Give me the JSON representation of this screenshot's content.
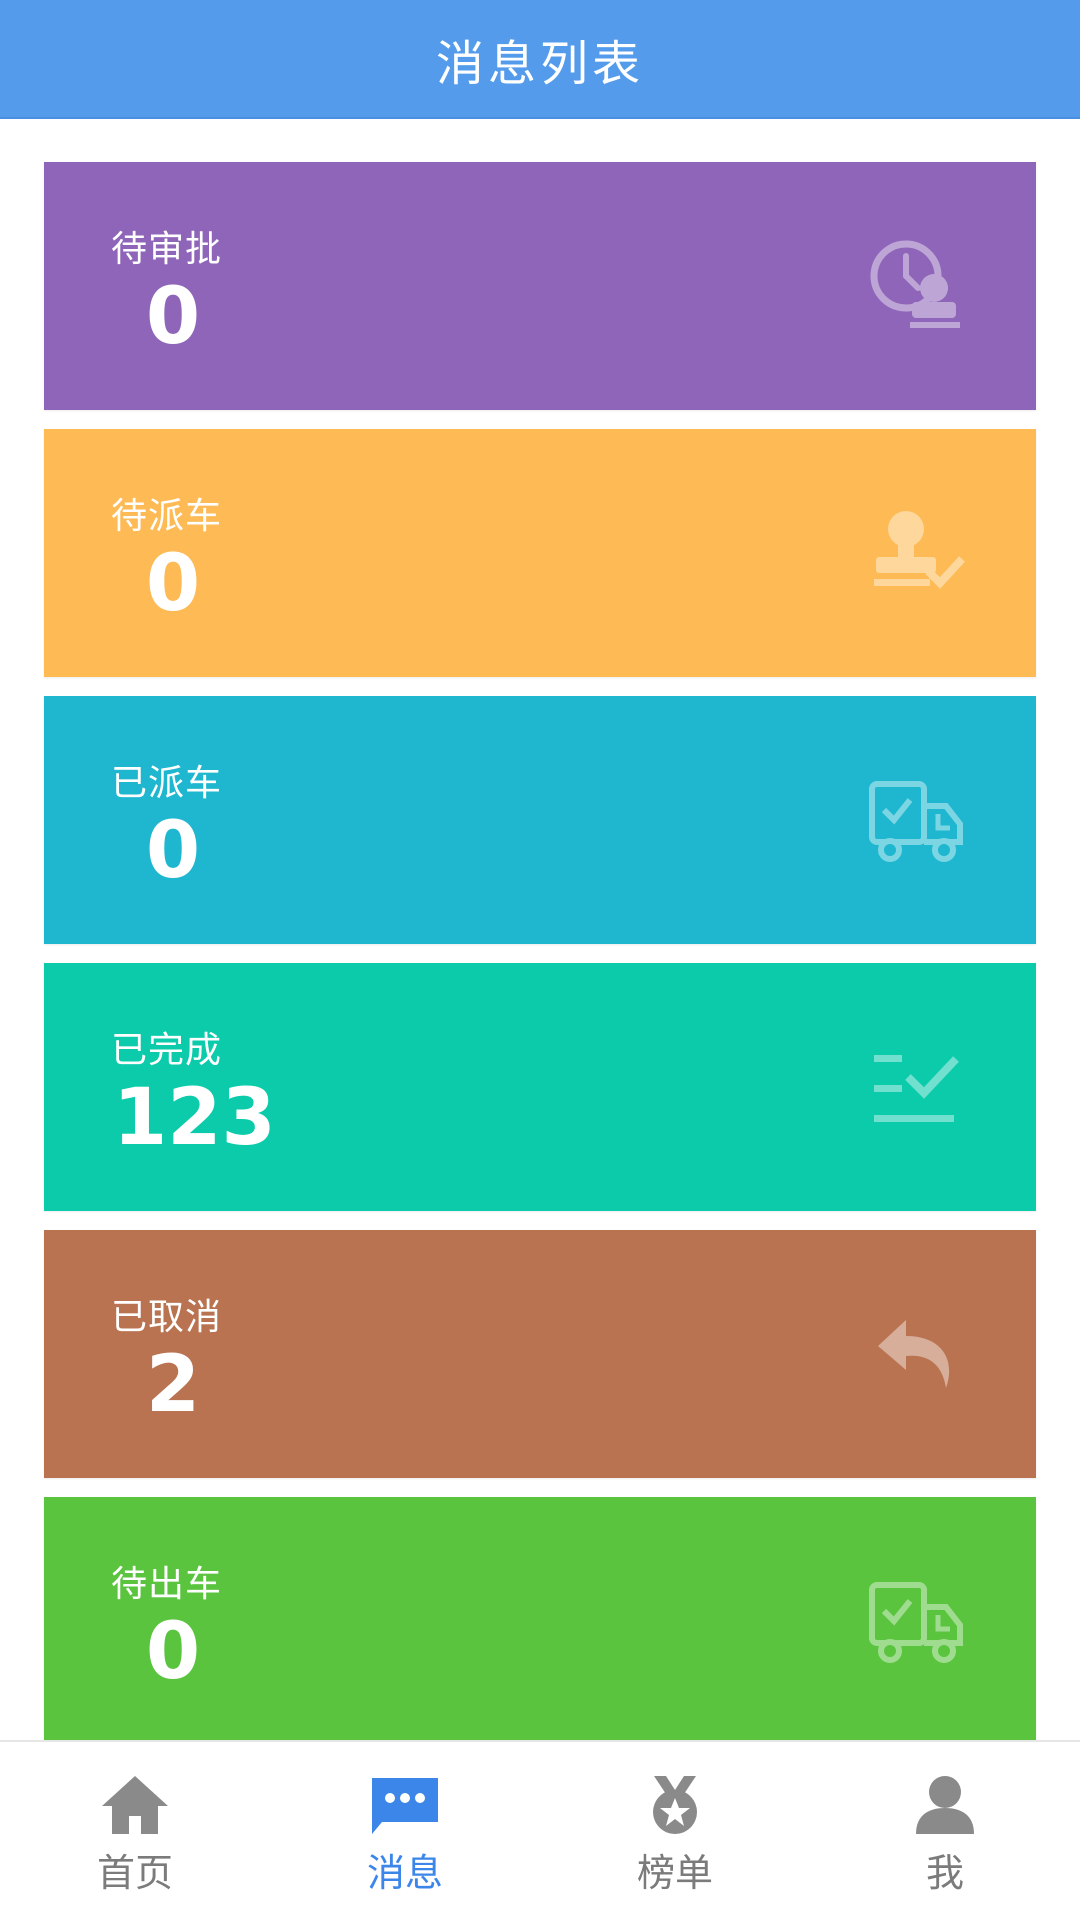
{
  "header": {
    "title": "消息列表"
  },
  "cards": [
    {
      "label": "待审批",
      "value": "0",
      "color": "#8E65B9",
      "icon": "clock-user-icon"
    },
    {
      "label": "待派车",
      "value": "0",
      "color": "#FDBA55",
      "icon": "stamp-check-icon"
    },
    {
      "label": "已派车",
      "value": "0",
      "color": "#1EB7CF",
      "icon": "truck-check-icon"
    },
    {
      "label": "已完成",
      "value": "123",
      "color": "#0BCBAB",
      "icon": "list-check-icon"
    },
    {
      "label": "已取消",
      "value": "2",
      "color": "#B97351",
      "icon": "undo-arrow-icon"
    },
    {
      "label": "待出车",
      "value": "0",
      "color": "#5AC43F",
      "icon": "truck-check-icon"
    }
  ],
  "tabbar": {
    "active_color": "#3b86e8",
    "inactive_color": "#7b7b7b",
    "items": [
      {
        "label": "首页",
        "icon": "home-icon",
        "active": false
      },
      {
        "label": "消息",
        "icon": "message-icon",
        "active": true
      },
      {
        "label": "榜单",
        "icon": "medal-icon",
        "active": false
      },
      {
        "label": "我",
        "icon": "user-icon",
        "active": false
      }
    ]
  }
}
